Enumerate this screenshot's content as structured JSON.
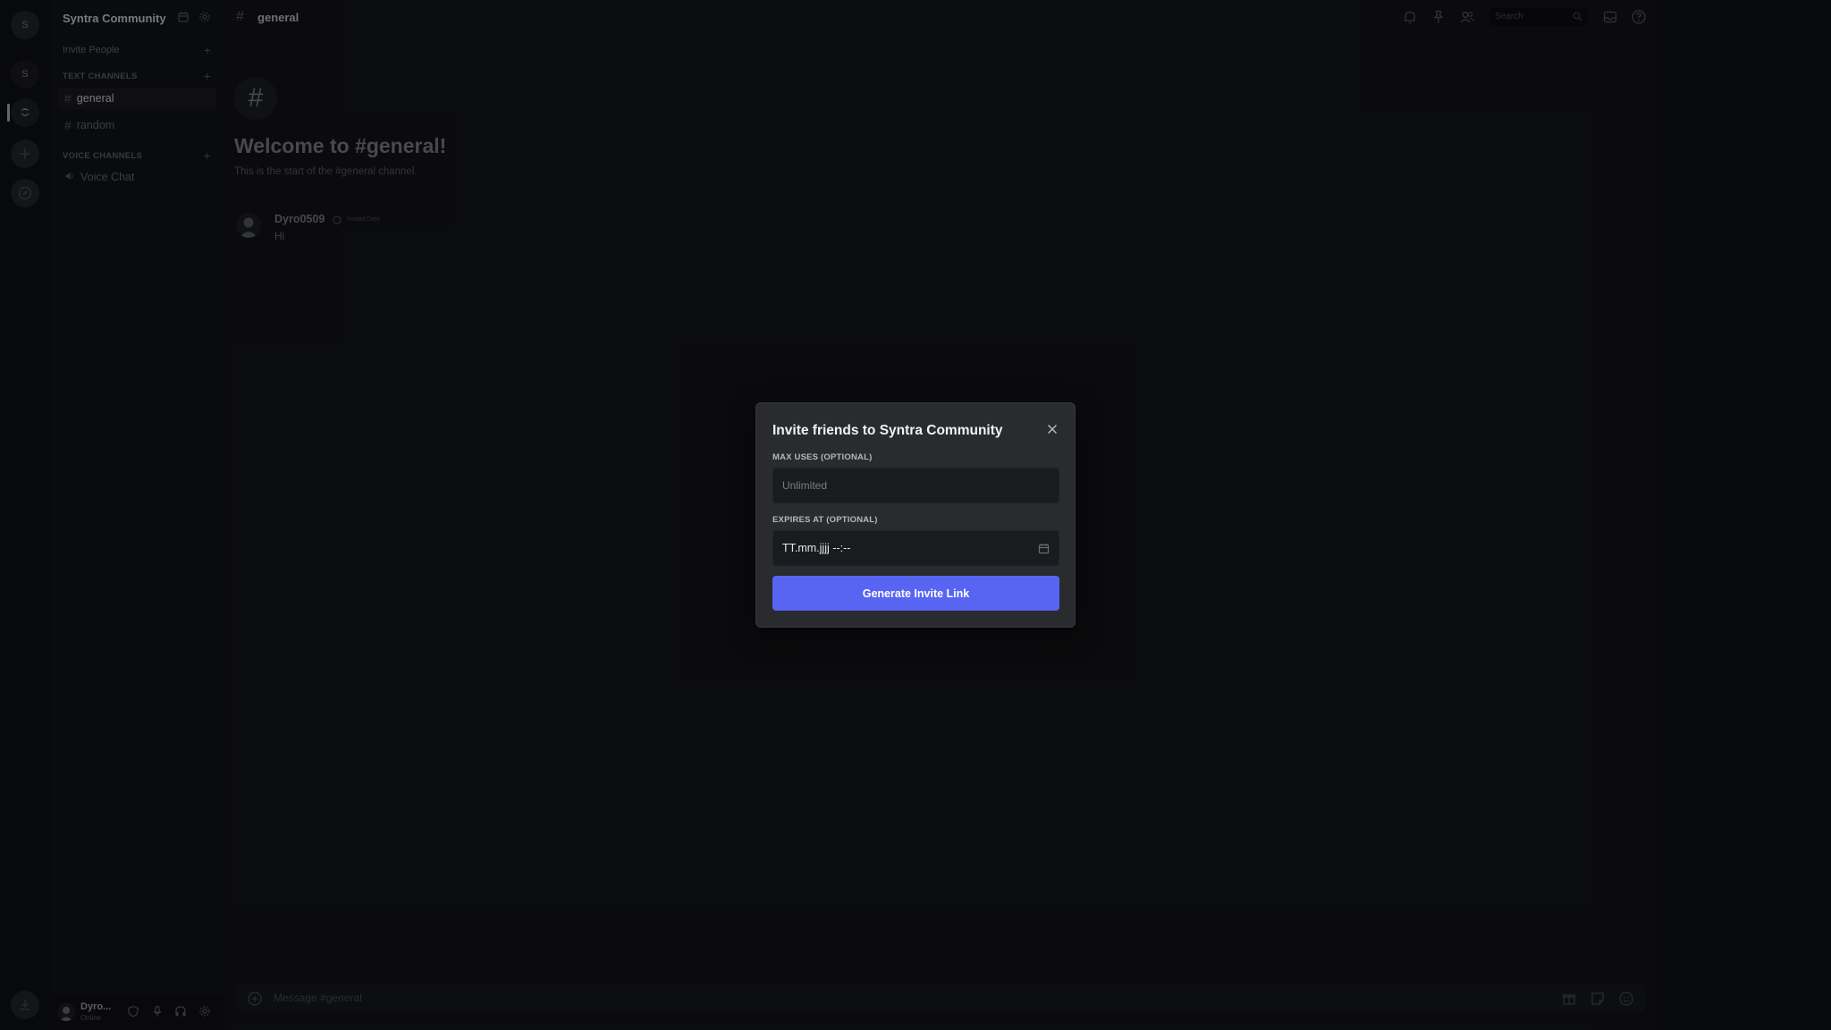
{
  "rail": {
    "home_label": "S",
    "server_s_label": "S",
    "active_server_label": "Syntra"
  },
  "sidebar": {
    "server_name": "Syntra Community",
    "invite_people": "Invite People",
    "text_category": "TEXT CHANNELS",
    "voice_category": "VOICE CHANNELS",
    "text_channels": [
      {
        "label": "general",
        "selected": true
      },
      {
        "label": "random",
        "selected": false
      }
    ],
    "voice_channels": [
      {
        "label": "Voice Chat"
      }
    ]
  },
  "user_panel": {
    "username": "Dyro...",
    "status": "Online"
  },
  "header": {
    "channel_name": "general",
    "search_placeholder": "Search"
  },
  "main": {
    "welcome_title": "Welcome to #general!",
    "welcome_subtitle": "This is the start of the #general channel.",
    "message": {
      "author": "Dyro0509",
      "time": "Invalid Date",
      "text": "Hi"
    },
    "composer_placeholder": "Message #general"
  },
  "modal": {
    "title": "Invite friends to Syntra Community",
    "max_uses_label": "MAX USES (OPTIONAL)",
    "max_uses_placeholder": "Unlimited",
    "expires_label": "EXPIRES AT (OPTIONAL)",
    "expires_value": "TT.mm.jjjj --:--",
    "generate_button": "Generate Invite Link"
  },
  "colors": {
    "accent": "#5865f2",
    "modal_bg": "#2a2b2f",
    "app_bg": "#111215"
  }
}
